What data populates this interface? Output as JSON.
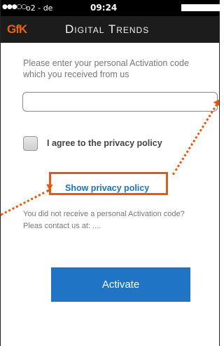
{
  "status_bar": {
    "signal": "●●●○○",
    "carrier": "o2 - de",
    "time": "09:24"
  },
  "header": {
    "logo": "GfK",
    "title": "Digital Trends"
  },
  "activation": {
    "intro_text": "Please enter your personal Activation code which you received from us",
    "code_value": ""
  },
  "privacy": {
    "checkbox_label": "I agree to the privacy policy",
    "checked": false,
    "show_link": "Show privacy policy"
  },
  "contact": {
    "line1": "You did not receive a personal  Activation code?",
    "line2": "Pleas contact us at: ...."
  },
  "actions": {
    "activate_label": "Activate"
  },
  "colors": {
    "accent": "#1f74c6",
    "highlight": "#e05a16",
    "logo": "#e8631a",
    "header_bg": "#1c1c1c"
  }
}
